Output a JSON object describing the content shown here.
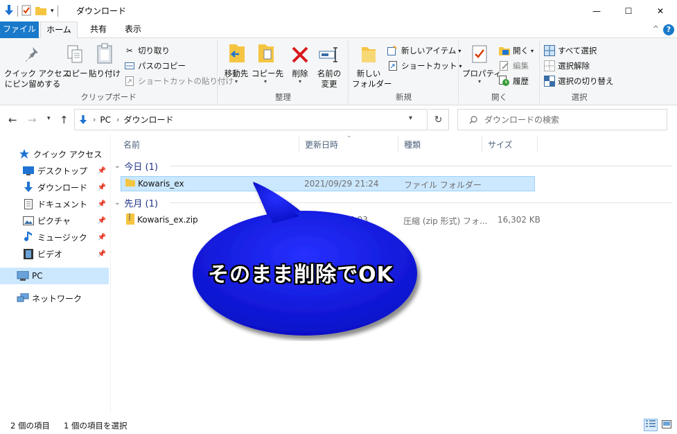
{
  "window": {
    "title": "ダウンロード",
    "controls": {
      "minimize": "—",
      "maximize": "☐",
      "close": "✕"
    }
  },
  "ribbon": {
    "tabs": [
      {
        "label": "ファイル"
      },
      {
        "label": "ホーム"
      },
      {
        "label": "共有"
      },
      {
        "label": "表示"
      }
    ],
    "collapse": "^",
    "help": "?",
    "groups": {
      "clipboard": {
        "label": "クリップボード",
        "pin_quick_line1": "クイック アクセス",
        "pin_quick_line2": "にピン留めする",
        "copy": "コピー",
        "paste": "貼り付け",
        "cut": "切り取り",
        "copy_path": "パスのコピー",
        "paste_shortcut": "ショートカットの貼り付け"
      },
      "organize": {
        "label": "整理",
        "move_to": "移動先",
        "copy_to": "コピー先",
        "delete": "削除",
        "rename_line1": "名前の",
        "rename_line2": "変更"
      },
      "new": {
        "label": "新規",
        "new_folder_line1": "新しい",
        "new_folder_line2": "フォルダー",
        "new_item": "新しいアイテム",
        "shortcut": "ショートカット"
      },
      "open": {
        "label": "開く",
        "properties": "プロパティ",
        "open": "開く",
        "edit": "編集",
        "history": "履歴"
      },
      "select": {
        "label": "選択",
        "select_all": "すべて選択",
        "select_none": "選択解除",
        "invert": "選択の切り替え"
      }
    }
  },
  "address": {
    "crumbs": [
      "PC",
      "ダウンロード"
    ],
    "search_placeholder": "ダウンロードの検索"
  },
  "nav": {
    "quick_access": "クイック アクセス",
    "items": [
      {
        "label": "デスクトップ"
      },
      {
        "label": "ダウンロード"
      },
      {
        "label": "ドキュメント"
      },
      {
        "label": "ピクチャ"
      },
      {
        "label": "ミュージック"
      },
      {
        "label": "ビデオ"
      }
    ],
    "pc": "PC",
    "network": "ネットワーク"
  },
  "files": {
    "columns": {
      "name": "名前",
      "modified": "更新日時",
      "type": "種類",
      "size": "サイズ"
    },
    "groups": [
      {
        "label": "今日 (1)",
        "rows": [
          {
            "name": "Kowaris_ex",
            "modified": "2021/09/29 21:24",
            "type": "ファイル フォルダー",
            "size": ""
          }
        ]
      },
      {
        "label": "先月 (1)",
        "rows": [
          {
            "name": "Kowaris_ex.zip",
            "modified": "5:03",
            "type": "圧縮 (zip 形式) フォ...",
            "size": "16,302 KB"
          }
        ]
      }
    ]
  },
  "status": {
    "count": "2 個の項目",
    "selected": "1 個の項目を選択"
  },
  "annotation": {
    "text": "そのまま削除でOK",
    "fill": "#0a14d8"
  }
}
